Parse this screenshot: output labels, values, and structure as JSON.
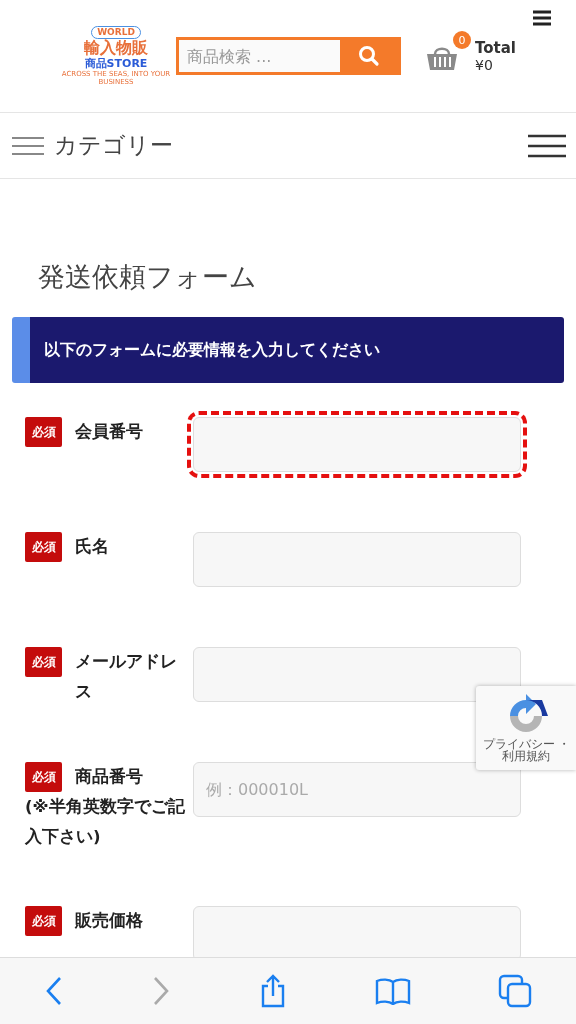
{
  "header": {
    "logo": {
      "badge": "WORLD",
      "title": "輸入物販",
      "subtitle_jp": "商品",
      "subtitle_en": "STORE",
      "tagline": "ACROSS THE SEAS, INTO YOUR BUSINESS"
    },
    "search": {
      "placeholder": "商品検索 ..."
    },
    "cart": {
      "count": "0",
      "label": "Total",
      "amount": "¥0"
    }
  },
  "category_bar": {
    "label": "カテゴリー"
  },
  "page_title": "発送依頼フォーム",
  "banner": "以下のフォームに必要情報を入力してください",
  "fields": [
    {
      "badge": "必須",
      "label": "会員番号",
      "highlighted": true
    },
    {
      "badge": "必須",
      "label": "氏名",
      "highlighted": false
    },
    {
      "badge": "必須",
      "label": "メールアドレス",
      "highlighted": false
    },
    {
      "badge": "必須",
      "label": "商品番号",
      "note": "(※半角英数字でご記入下さい)",
      "placeholder": "例：000010L",
      "highlighted": false
    },
    {
      "badge": "必須",
      "label": "販売価格",
      "highlighted": false
    }
  ],
  "recaptcha": {
    "privacy": "プライバシー",
    "separator": "・",
    "terms": "利用規約"
  },
  "toolbar": [
    {
      "kind": "back",
      "disabled": false
    },
    {
      "kind": "forward",
      "disabled": true
    },
    {
      "kind": "share",
      "disabled": false
    },
    {
      "kind": "bookmarks",
      "disabled": false
    },
    {
      "kind": "tabs",
      "disabled": false
    }
  ]
}
